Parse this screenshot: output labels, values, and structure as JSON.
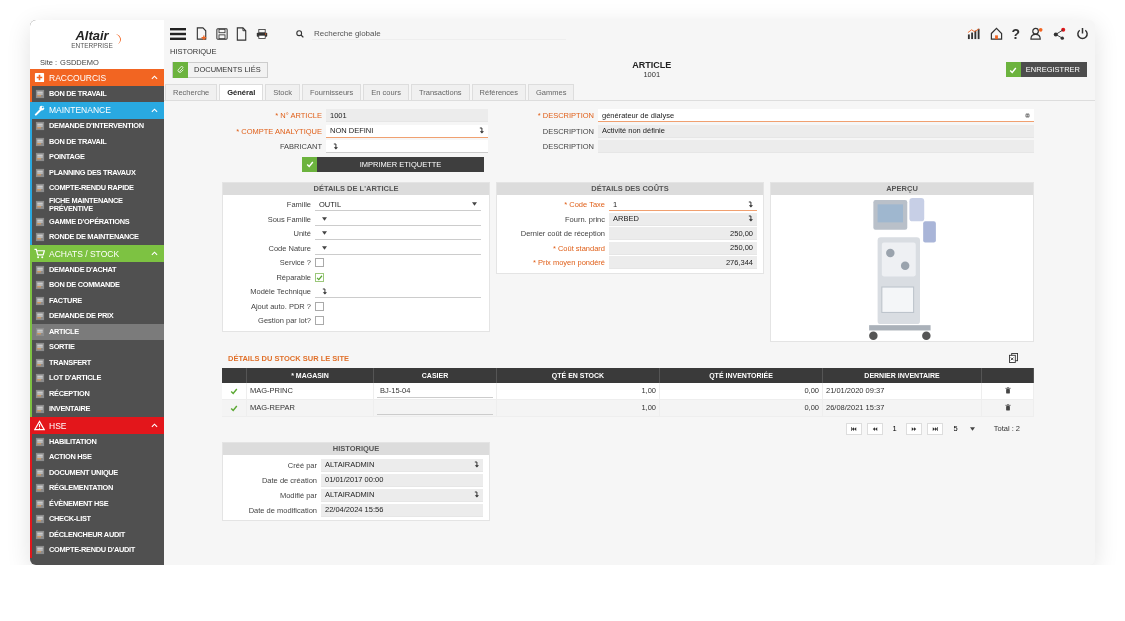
{
  "sidebar": {
    "logo": "Altair",
    "logo_sub": "ENTERPRISE",
    "site_label": "Site :",
    "site": "GSDDEMO",
    "sections": [
      {
        "title": "RACCOURCIS",
        "kind": "plus",
        "color": "#f26522",
        "expanded": true,
        "items": [
          {
            "label": "BON DE TRAVAIL",
            "selected": false
          }
        ]
      },
      {
        "title": "MAINTENANCE",
        "kind": "wrench",
        "color": "#29a9e1",
        "expanded": true,
        "items": [
          {
            "label": "DEMANDE D'INTERVENTION",
            "selected": false
          },
          {
            "label": "BON DE TRAVAIL",
            "selected": false
          },
          {
            "label": "POINTAGE",
            "selected": false
          },
          {
            "label": "PLANNING DES TRAVAUX",
            "selected": false
          },
          {
            "label": "COMPTE-RENDU RAPIDE",
            "selected": false
          },
          {
            "label": "FICHE MAINTENANCE\nPRÉVENTIVE",
            "selected": false
          },
          {
            "label": "GAMME D'OPÉRATIONS",
            "selected": false
          },
          {
            "label": "RONDE DE MAINTENANCE",
            "selected": false
          }
        ]
      },
      {
        "title": "ACHATS / STOCK",
        "kind": "cart",
        "color": "#7dc242",
        "expanded": true,
        "items": [
          {
            "label": "DEMANDE D'ACHAT",
            "selected": false
          },
          {
            "label": "BON DE COMMANDE",
            "selected": false
          },
          {
            "label": "FACTURE",
            "selected": false
          },
          {
            "label": "DEMANDE DE PRIX",
            "selected": false
          },
          {
            "label": "ARTICLE",
            "selected": true
          },
          {
            "label": "SORTIE",
            "selected": false
          },
          {
            "label": "TRANSFERT",
            "selected": false
          },
          {
            "label": "LOT D'ARTICLE",
            "selected": false
          },
          {
            "label": "RÉCEPTION",
            "selected": false
          },
          {
            "label": "INVENTAIRE",
            "selected": false
          }
        ]
      },
      {
        "title": "HSE",
        "kind": "warning",
        "color": "#e3161b",
        "expanded": true,
        "items": [
          {
            "label": "HABILITATION",
            "selected": false
          },
          {
            "label": "ACTION HSE",
            "selected": false
          },
          {
            "label": "DOCUMENT UNIQUE",
            "selected": false
          },
          {
            "label": "RÉGLEMENTATION",
            "selected": false
          },
          {
            "label": "ÉVÈNEMENT HSE",
            "selected": false
          },
          {
            "label": "CHECK-LIST",
            "selected": false
          },
          {
            "label": "DÉCLENCHEUR AUDIT",
            "selected": false
          },
          {
            "label": "COMPTE-RENDU D'AUDIT",
            "selected": false
          }
        ]
      }
    ]
  },
  "toolbar": {
    "search": {
      "placeholder": "Recherche globale"
    },
    "help": "?"
  },
  "breadcrumb": "HISTORIQUE",
  "documents_button": "DOCUMENTS LIÉS",
  "title": "ARTICLE",
  "subtitle": "1001",
  "save_button": "ENREGISTRER",
  "tabs": [
    {
      "label": "Recherche",
      "selected": false
    },
    {
      "label": "Général",
      "selected": true
    },
    {
      "label": "Stock",
      "selected": false
    },
    {
      "label": "Fournisseurs",
      "selected": false
    },
    {
      "label": "En cours",
      "selected": false
    },
    {
      "label": "Transactions",
      "selected": false
    },
    {
      "label": "Références",
      "selected": false
    },
    {
      "label": "Gammes",
      "selected": false
    }
  ],
  "form_left": [
    {
      "label": "* N° ARTICLE",
      "required": true,
      "kind": "text",
      "readonly": true,
      "value": "1001"
    },
    {
      "label": "* COMPTE ANALYTIQUE",
      "required": true,
      "kind": "lookup",
      "readonly": false,
      "value": "NON DEFINI"
    },
    {
      "label": "FABRICANT",
      "required": false,
      "kind": "lookup",
      "readonly": false
    }
  ],
  "print_button": "IMPRIMER ETIQUETTE",
  "form_right": [
    {
      "label": "* DESCRIPTION",
      "required": true,
      "kind": "globe",
      "readonly": false,
      "value": "générateur de dialyse"
    },
    {
      "label": "DESCRIPTION",
      "required": false,
      "kind": "text",
      "readonly": true,
      "value": "Activité non définie"
    },
    {
      "label": "DESCRIPTION",
      "required": false,
      "kind": "text",
      "readonly": true
    }
  ],
  "article_details": {
    "title": "DÉTAILS DE L'ARTICLE",
    "rows": [
      {
        "label": "Famille",
        "required": false,
        "kind": "select",
        "readonly": false,
        "value": "OUTIL"
      },
      {
        "label": "Sous Famille",
        "required": false,
        "kind": "select",
        "readonly": false
      },
      {
        "label": "Unité",
        "required": false,
        "kind": "select",
        "readonly": false
      },
      {
        "label": "Code Nature",
        "required": false,
        "kind": "select",
        "readonly": false
      },
      {
        "label": "Service ?",
        "required": false,
        "kind": "checkbox",
        "checked": false
      },
      {
        "label": "Réparable",
        "required": false,
        "kind": "checkbox",
        "checked": true
      },
      {
        "label": "Modèle Technique",
        "required": false,
        "kind": "lookup",
        "readonly": false
      },
      {
        "label": "Ajout auto. PDR ?",
        "required": false,
        "kind": "checkbox",
        "checked": false
      },
      {
        "label": "Gestion par lot?",
        "required": false,
        "kind": "checkbox",
        "checked": false
      }
    ]
  },
  "cost_details": {
    "title": "DÉTAILS DES COÛTS",
    "rows": [
      {
        "label": "* Code Taxe",
        "required": true,
        "kind": "lookup",
        "readonly": false,
        "value": "1"
      },
      {
        "label": "Fourn. princ",
        "required": false,
        "kind": "lookup",
        "readonly": true,
        "value": "ARBED"
      },
      {
        "label": "Dernier coût de réception",
        "required": false,
        "kind": "number",
        "readonly": true,
        "value": "250,00"
      },
      {
        "label": "* Coût standard",
        "required": true,
        "kind": "number",
        "readonly": true,
        "value": "250,00"
      },
      {
        "label": "* Prix moyen pondéré",
        "required": true,
        "kind": "number",
        "readonly": true,
        "value": "276,344"
      }
    ]
  },
  "preview": {
    "title": "APERÇU"
  },
  "stock": {
    "title": "DÉTAILS DU STOCK SUR LE SITE",
    "columns": [
      "* MAGASIN",
      "CASIER",
      "QTÉ EN STOCK",
      "QTÉ INVENTORIÉE",
      "DERNIER INVENTAIRE"
    ],
    "rows": [
      {
        "magasin": "MAG-PRINC",
        "casier": "BJ-15-04",
        "qty_stock": "1,00",
        "qty_inventoried": "0,00",
        "last_inventory": "21/01/2020 09:37"
      },
      {
        "magasin": "MAG-REPAR",
        "qty_stock": "1,00",
        "qty_inventoried": "0,00",
        "last_inventory": "26/08/2021 15:37"
      }
    ],
    "pagination": {
      "page": "1",
      "page_size": "5",
      "total": "Total : 2"
    }
  },
  "history": {
    "title": "HISTORIQUE",
    "rows": [
      {
        "label": "Créé par",
        "required": false,
        "kind": "lookup",
        "readonly": true,
        "value": "ALTAIRADMIN"
      },
      {
        "label": "Date de création",
        "required": false,
        "kind": "text",
        "readonly": true,
        "value": "01/01/2017 00:00"
      },
      {
        "label": "Modifié par",
        "required": false,
        "kind": "lookup",
        "readonly": true,
        "value": "ALTAIRADMIN"
      },
      {
        "label": "Date de modification",
        "required": false,
        "kind": "text",
        "readonly": true,
        "value": "22/04/2024 15:56"
      }
    ]
  }
}
